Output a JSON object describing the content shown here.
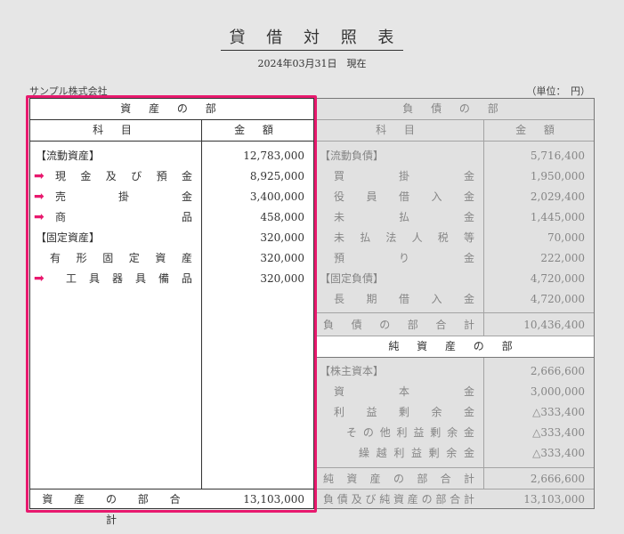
{
  "document": {
    "title": "貸 借 対 照 表",
    "date": "2024年03月31日　現在",
    "company": "サンプル株式会社",
    "unit": "（単位：　円）"
  },
  "assets": {
    "section_title": "資 産 の 部",
    "col_item": "科 目",
    "col_amount": "金 額",
    "rows": [
      {
        "label": "【流動資産】",
        "amount": "12,783,000"
      },
      {
        "label": "現金及び預金",
        "amount": "8,925,000"
      },
      {
        "label": "売掛金",
        "amount": "3,400,000"
      },
      {
        "label": "商品",
        "amount": "458,000"
      },
      {
        "label": "【固定資産】",
        "amount": "320,000"
      },
      {
        "label": "有形固定資産",
        "amount": "320,000"
      },
      {
        "label": "工具器具備品",
        "amount": "320,000"
      }
    ],
    "total_label": "資 産 の 部 合 計",
    "total_amount": "13,103,000"
  },
  "liabilities": {
    "section_title": "負 債 の 部",
    "col_item": "科 目",
    "col_amount": "金 額",
    "rows": [
      {
        "label": "【流動負債】",
        "amount": "5,716,400"
      },
      {
        "label": "買掛金",
        "amount": "1,950,000"
      },
      {
        "label": "役員借入金",
        "amount": "2,029,400"
      },
      {
        "label": "未払金",
        "amount": "1,445,000"
      },
      {
        "label": "未払法人税等",
        "amount": "70,000"
      },
      {
        "label": "預り金",
        "amount": "222,000"
      },
      {
        "label": "【固定負債】",
        "amount": "4,720,000"
      },
      {
        "label": "長期借入金",
        "amount": "4,720,000"
      }
    ],
    "total_label": "負 債 の 部 合 計",
    "total_amount": "10,436,400"
  },
  "net_assets": {
    "section_title": "純 資 産 の 部",
    "rows": [
      {
        "label": "【株主資本】",
        "amount": "2,666,600"
      },
      {
        "label": "資本金",
        "amount": "3,000,000"
      },
      {
        "label": "利益剰余金",
        "amount": "△333,400"
      },
      {
        "label": "その他利益剰余金",
        "amount": "△333,400"
      },
      {
        "label": "繰越利益剰余金",
        "amount": "△333,400"
      }
    ],
    "total_label": "純 資 産 の 部 合 計",
    "total_amount": "2,666,600",
    "grand_total_label": "負債及び純資産の部合計",
    "grand_total_amount": "13,103,000"
  },
  "colors": {
    "highlight": "#e8196e",
    "arrow": "#e8196e"
  }
}
